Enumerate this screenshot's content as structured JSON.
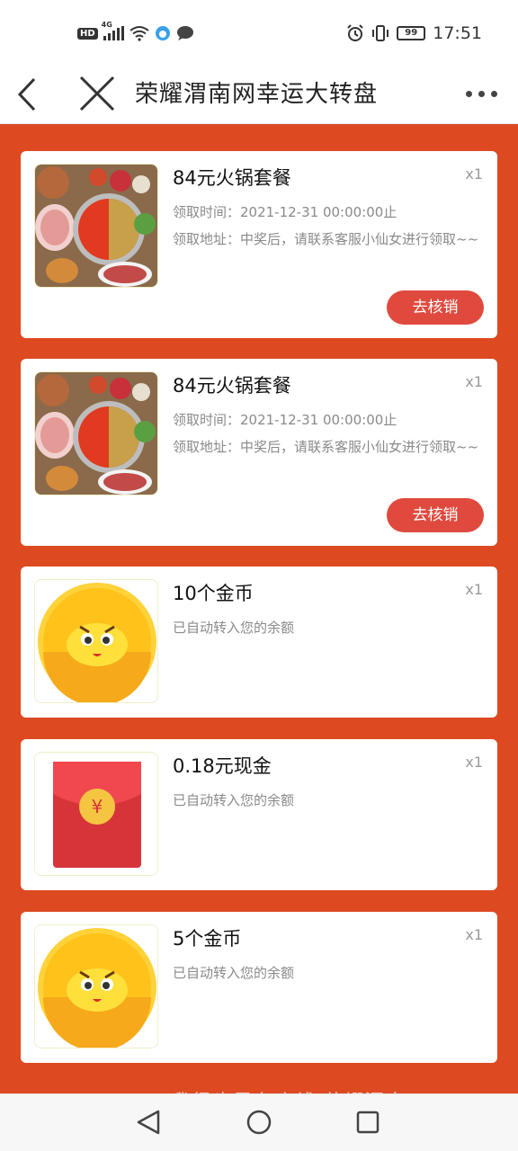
{
  "status_bar": {
    "hd": "HD",
    "network": "4G",
    "battery": "99",
    "time": "17:51"
  },
  "nav": {
    "title": "荣耀渭南网幸运大转盘"
  },
  "prizes": [
    {
      "title": "84元火锅套餐",
      "qty": "x1",
      "image": "hotpot-image",
      "line1": "领取时间：2021-12-31 00:00:00止",
      "line2": "领取地址：中奖后，请联系客服小仙女进行领取~~",
      "button": "去核销"
    },
    {
      "title": "84元火锅套餐",
      "qty": "x1",
      "image": "hotpot-image",
      "line1": "领取时间：2021-12-31 00:00:00止",
      "line2": "领取地址：中奖后，请联系客服小仙女进行领取~~",
      "button": "去核销"
    },
    {
      "title": "10个金币",
      "qty": "x1",
      "image": "gold-coin-image",
      "line1": "已自动转入您的余额"
    },
    {
      "title": "0.18元现金",
      "qty": "x1",
      "image": "red-envelope-image",
      "line1": "已自动转入您的余额"
    },
    {
      "title": "5个金币",
      "qty": "x1",
      "image": "gold-coin-image",
      "line1": "已自动转入您的余额"
    }
  ],
  "footer_text": "我很也是有底线/荣耀渭南",
  "colors": {
    "page_bg": "#dd4a22",
    "button": "#e04a3e"
  }
}
